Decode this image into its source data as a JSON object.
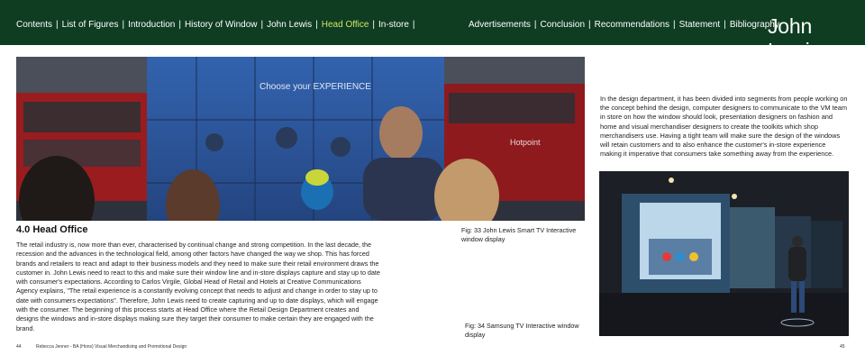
{
  "nav": {
    "left": [
      "Contents",
      "List of Figures",
      "Introduction",
      "History of Window",
      "John Lewis",
      "Head Office",
      "In-store"
    ],
    "right": [
      "Advertisements",
      "Conclusion",
      "Recommendations",
      "Statement",
      "Bibliography"
    ],
    "active": "Head Office",
    "active_color": "#cfe36a",
    "bar_color": "#0f3d21"
  },
  "logo": "John Lewis",
  "section": {
    "heading": "4.0 Head Office",
    "body": "The retail industry is, now more than ever, characterised by continual change and strong competition. In the last decade, the recession and the advances in the technological field, among other factors have changed the way we shop. This has forced brands and retailers to react and adapt to their business models and they need to make sure their retail environment draws the customer in. John Lewis need to react to this and make sure their window line and in-store displays capture and stay up to date with consumer's expectations. According to Carlos Virgile, Global Head of Retail and Hotels at Creative Communications Agency explains, \"The retail experience is a constantly evolving concept that needs to adjust and change in order to stay up to date with consumers expectations\". Therefore, John Lewis need to create capturing and up to date displays, which will engage with the consumer. The beginning of this process starts at Head Office where the Retail Design Department creates and designs the windows and in-store displays making sure they target their consumer to make certain they are engaged with the brand."
  },
  "right_paragraph": "In the design department, it has been divided into segments from people working on the concept behind the design, computer designers to communicate to the VM team in store on how the window should look, presentation designers on fashion and home and visual merchandiser designers to create the toolkits which shop merchandisers use. Having a tight team will make sure the design of the windows will retain customers and to also enhance the customer's in-store experience making it imperative that consumers take something away from the experience.",
  "photo1": {
    "screen_text": "Choose your EXPERIENCE",
    "bus_text": "Hotpoint"
  },
  "captions": {
    "fig33": "Fig: 33 John Lewis Smart TV Interactive window display",
    "fig34": "Fig: 34 Samsung TV Interactive window display"
  },
  "footer": {
    "page_left": "44",
    "author": "Rebecca Jenner - BA (Hons) Visual Merchandising and Promotional Design",
    "page_right": "45"
  }
}
